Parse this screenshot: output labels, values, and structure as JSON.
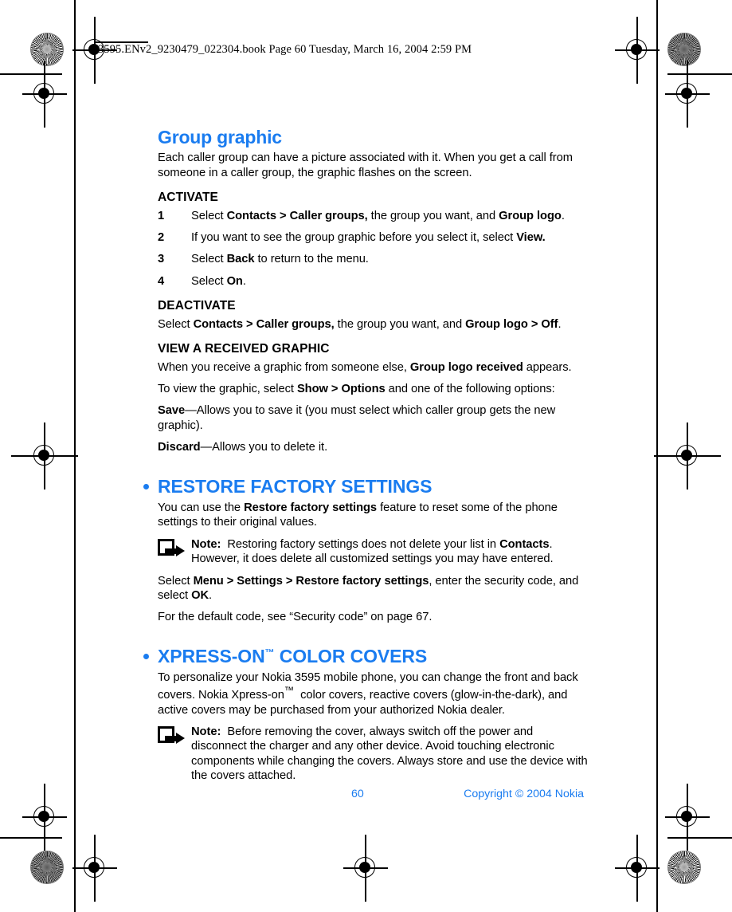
{
  "header": {
    "file_line": "3595.ENv2_9230479_022304.book  Page 60  Tuesday, March 16, 2004  2:59 PM"
  },
  "content": {
    "chapter_title": "Group graphic",
    "intro": "Each caller group can have a picture associated with it. When you get a call from someone in a caller group, the graphic flashes on the screen.",
    "activate_head": "ACTIVATE",
    "steps": [
      {
        "num": "1",
        "text_html": "Select <b>Contacts &gt; Caller groups,</b> the group you want, and <b>Group logo</b>."
      },
      {
        "num": "2",
        "text_html": "If you want to see the group graphic before you select it, select <b>View.</b>"
      },
      {
        "num": "3",
        "text_html": "Select <b>Back</b> to return to the menu."
      },
      {
        "num": "4",
        "text_html": "Select <b>On</b>."
      }
    ],
    "deactivate_head": "DEACTIVATE",
    "deactivate_text_html": "Select <b>Contacts &gt; Caller groups,</b> the group you want, and <b>Group logo &gt; Off</b>.",
    "view_graphic_head": "VIEW A RECEIVED GRAPHIC",
    "view_graphic_p1_html": "When you receive a graphic from someone else, <b>Group logo received</b> appears.",
    "view_graphic_p2_html": "To view the graphic, select <b>Show &gt; Options</b> and one of the following options:",
    "option_save_html": "<b>Save</b>&#8212;Allows you to save it (you must select which caller group gets the new graphic).",
    "option_discard_html": "<b>Discard</b>&#8212;Allows you to delete it.",
    "restore_section_title": "RESTORE FACTORY SETTINGS",
    "restore_intro_html": "You can use the <b>Restore factory settings</b> feature to reset some of the phone settings to their original values.",
    "restore_note_html": "<b>Note:</b>&nbsp; Restoring factory settings does not delete your list in <b>Contacts</b>. However, it does delete all customized settings you may have entered.",
    "restore_steps_html": "Select <b>Menu &gt; Settings &gt; Restore factory settings</b>, enter the security code, and select <b>OK</b>.",
    "restore_default_code_html": "For the default code, see &#8220;Security code&#8221; on page 67.",
    "xpress_section_title_html": "XPRESS-ON<sup class=\"tm\">™</sup> COLOR COVERS",
    "xpress_intro_html": "To personalize your Nokia 3595 mobile phone, you can change the front and back covers. Nokia Xpress-on<sup>™</sup>&nbsp; color covers, reactive covers (glow-in-the-dark), and active covers may be purchased from your authorized Nokia dealer.",
    "xpress_note_html": "<b>Note:</b>&nbsp; Before removing the cover, always switch off the power and disconnect the charger and any other device. Avoid touching electronic components while changing the covers. Always store and use the device with the covers attached."
  },
  "footer": {
    "page_number": "60",
    "copyright": "Copyright © 2004 Nokia"
  },
  "colors": {
    "heading_blue": "#1a7cf0",
    "body_black": "#000000",
    "page_background": "#ffffff"
  }
}
